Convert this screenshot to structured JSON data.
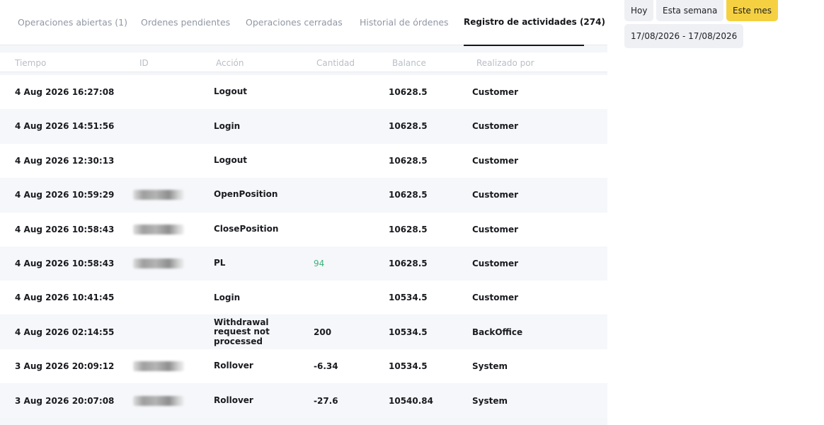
{
  "tabs": [
    {
      "label": "Operaciones abiertas (1)",
      "active": false
    },
    {
      "label": "Ordenes pendientes",
      "active": false
    },
    {
      "label": "Operaciones cerradas",
      "active": false
    },
    {
      "label": "Historial de órdenes",
      "active": false
    },
    {
      "label": "Registro de actividades (274)",
      "active": true
    }
  ],
  "table": {
    "columns": [
      "Tiempo",
      "ID",
      "Acción",
      "Cantidad",
      "Balance",
      "Realizado por"
    ],
    "rows": [
      {
        "time": "4 Aug 2026 16:27:08",
        "id_redacted": false,
        "action": "Logout",
        "amount": "",
        "balance": "10628.5",
        "by": "Customer"
      },
      {
        "time": "4 Aug 2026 14:51:56",
        "id_redacted": false,
        "action": "Login",
        "amount": "",
        "balance": "10628.5",
        "by": "Customer"
      },
      {
        "time": "4 Aug 2026 12:30:13",
        "id_redacted": false,
        "action": "Logout",
        "amount": "",
        "balance": "10628.5",
        "by": "Customer"
      },
      {
        "time": "4 Aug 2026 10:59:29",
        "id_redacted": true,
        "action": "OpenPosition",
        "amount": "",
        "balance": "10628.5",
        "by": "Customer"
      },
      {
        "time": "4 Aug 2026 10:58:43",
        "id_redacted": true,
        "action": "ClosePosition",
        "amount": "",
        "balance": "10628.5",
        "by": "Customer"
      },
      {
        "time": "4 Aug 2026 10:58:43",
        "id_redacted": true,
        "action": "PL",
        "amount": "94",
        "balance": "10628.5",
        "by": "Customer"
      },
      {
        "time": "4 Aug 2026 10:41:45",
        "id_redacted": false,
        "action": "Login",
        "amount": "",
        "balance": "10534.5",
        "by": "Customer"
      },
      {
        "time": "4 Aug 2026 02:14:55",
        "id_redacted": false,
        "action": "Withdrawal request not processed",
        "amount": "200",
        "balance": "10534.5",
        "by": "BackOffice"
      },
      {
        "time": "3 Aug 2026 20:09:12",
        "id_redacted": true,
        "action": "Rollover",
        "amount": "-6.34",
        "balance": "10534.5",
        "by": "System"
      },
      {
        "time": "3 Aug 2026 20:07:08",
        "id_redacted": true,
        "action": "Rollover",
        "amount": "-27.6",
        "balance": "10540.84",
        "by": "System"
      }
    ]
  },
  "filters": {
    "periods": [
      {
        "label": "Hoy",
        "active": false
      },
      {
        "label": "Esta semana",
        "active": false
      },
      {
        "label": "Este mes",
        "active": true
      }
    ],
    "date_range": "17/08/2026 - 17/08/2026"
  },
  "colors": {
    "accent": "#f5d142",
    "positive": "#3fb27a",
    "muted_text": "#9097a3"
  }
}
